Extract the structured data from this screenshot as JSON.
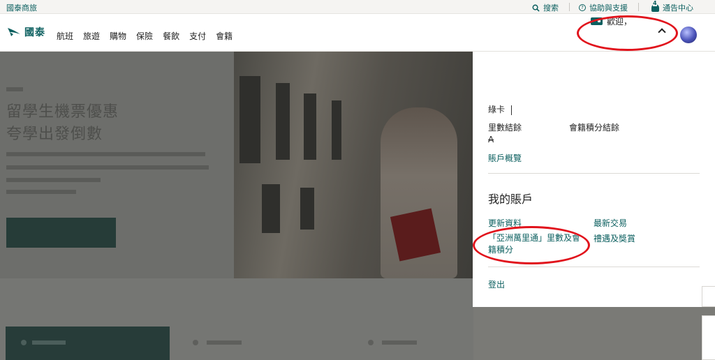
{
  "utility": {
    "brand_link": "國泰商旅",
    "search_label": "搜索",
    "help_label": "協助與支援",
    "help_icon_glyph": "?",
    "notification_count": "4",
    "notification_label": "通告中心"
  },
  "nav": {
    "logo_text": "國泰",
    "items": [
      "航班",
      "旅遊",
      "購物",
      "保險",
      "餐飲",
      "支付",
      "會籍"
    ],
    "welcome_label": "歡迎，"
  },
  "dropdown": {
    "tier_label": "綠卡",
    "miles_balance_label": "里數結餘",
    "miles_balance_value": "A",
    "status_points_label": "會籍積分結餘",
    "account_overview_link": "賬戶概覽",
    "my_account_heading": "我的賬戶",
    "update_profile_link": "更新資料",
    "latest_transactions_link": "最新交易",
    "asia_miles_link_line1": "「亞洲萬里通」里數及會",
    "asia_miles_link_line2": "籍積分",
    "benefits_rewards_link": "禮遇及獎賞",
    "logout_link": "登出"
  },
  "hero": {
    "title_line1": "留學生機票優惠",
    "title_line2": "夸學出發倒數"
  },
  "colors": {
    "brand_teal": "#0b5f5f",
    "annotation_red": "#e1131c",
    "overlay_grey": "#7a7a76"
  }
}
